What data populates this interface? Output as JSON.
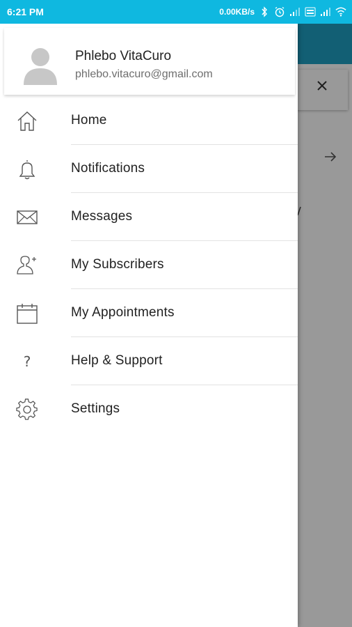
{
  "status_bar": {
    "time": "6:21 PM",
    "speed": "0.00KB/s",
    "icons": [
      "bluetooth-icon",
      "alarm-icon",
      "signal-icon",
      "volte-icon",
      "signal-icon",
      "wifi-icon"
    ],
    "color": "#0fb8e0"
  },
  "drawer": {
    "user": {
      "name": "Phlebo VitaCuro",
      "email": "phlebo.vitacuro@gmail.com"
    },
    "items": [
      {
        "label": "Home",
        "icon": "home-icon"
      },
      {
        "label": "Notifications",
        "icon": "bell-icon"
      },
      {
        "label": "Messages",
        "icon": "mail-icon"
      },
      {
        "label": "My Subscribers",
        "icon": "user-add-icon"
      },
      {
        "label": "My Appointments",
        "icon": "calendar-icon"
      },
      {
        "label": "Help & Support",
        "icon": "question-icon",
        "glyph": "?"
      },
      {
        "label": "Settings",
        "icon": "gear-icon"
      }
    ]
  },
  "background": {
    "appbar_color": "#1f9ec2",
    "icons": [
      "close-icon",
      "arrow-right-icon"
    ]
  }
}
